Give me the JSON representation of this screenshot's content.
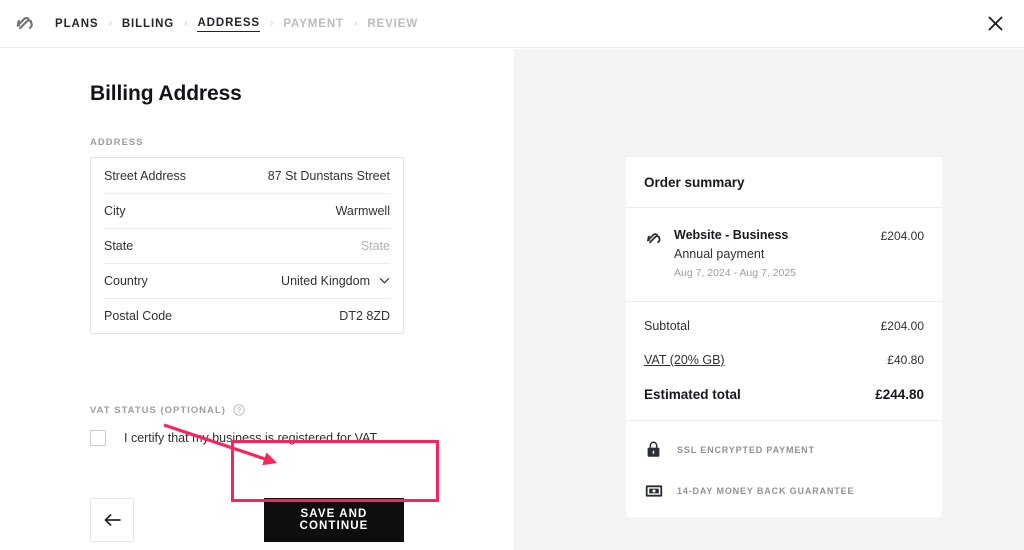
{
  "header": {
    "logo_icon": "squarespace-logo-icon",
    "close_icon": "close-icon",
    "breadcrumb": [
      {
        "label": "PLANS",
        "state": "done"
      },
      {
        "label": "BILLING",
        "state": "done"
      },
      {
        "label": "ADDRESS",
        "state": "active"
      },
      {
        "label": "PAYMENT",
        "state": "upcoming"
      },
      {
        "label": "REVIEW",
        "state": "upcoming"
      }
    ],
    "separator": "›"
  },
  "form": {
    "page_title": "Billing Address",
    "section_label": "ADDRESS",
    "fields": [
      {
        "label": "Street Address",
        "value": "87 St Dunstans Street",
        "placeholder": "Street Address",
        "is_placeholder": false,
        "has_chevron": false
      },
      {
        "label": "City",
        "value": "Warmwell",
        "placeholder": "City",
        "is_placeholder": false,
        "has_chevron": false
      },
      {
        "label": "State",
        "value": "State",
        "placeholder": "State",
        "is_placeholder": true,
        "has_chevron": false
      },
      {
        "label": "Country",
        "value": "United Kingdom",
        "placeholder": "Country",
        "is_placeholder": false,
        "has_chevron": true
      },
      {
        "label": "Postal Code",
        "value": "DT2 8ZD",
        "placeholder": "Postal Code",
        "is_placeholder": false,
        "has_chevron": false
      }
    ],
    "vat_status_label": "VAT STATUS (OPTIONAL)",
    "vat_help_icon": "help-circle-icon",
    "vat_checkbox_label": "I certify that my business is registered for VAT.",
    "vat_checked": false,
    "back_icon": "arrow-left-icon",
    "save_label": "SAVE AND CONTINUE"
  },
  "summary": {
    "title": "Order summary",
    "item": {
      "logo_icon": "squarespace-logo-icon",
      "name": "Website - Business",
      "billing_cycle": "Annual payment",
      "term": "Aug 7, 2024 - Aug 7, 2025",
      "price": "£204.00"
    },
    "totals": [
      {
        "label": "Subtotal",
        "value": "£204.00",
        "link": false,
        "grand": false
      },
      {
        "label": "VAT (20% GB)",
        "value": "£40.80",
        "link": true,
        "grand": false
      },
      {
        "label": "Estimated total",
        "value": "£244.80",
        "link": false,
        "grand": true
      }
    ],
    "trust": [
      {
        "icon": "lock-icon",
        "text": "SSL ENCRYPTED PAYMENT"
      },
      {
        "icon": "banknote-icon",
        "text": "14-DAY MONEY BACK GUARANTEE"
      }
    ]
  },
  "annotation": {
    "color": "#f5255e",
    "target": "save-and-continue-button"
  }
}
